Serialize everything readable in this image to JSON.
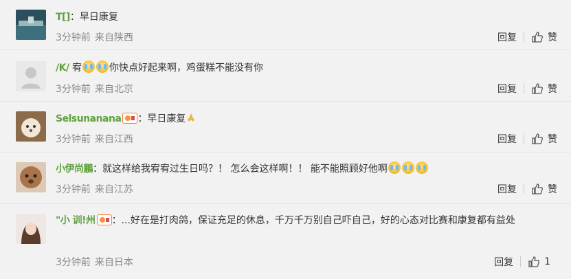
{
  "comments": [
    {
      "username": "T[]",
      "content": "：早日康复",
      "time": "3分钟前",
      "location": "来自陕西",
      "reply_label": "回复",
      "like_label": "赞"
    },
    {
      "username": "/K/",
      "content_a": "宥",
      "content_b": "你快点好起来啊，鸡蛋糕不能没有你",
      "time": "3分钟前",
      "location": "来自北京",
      "reply_label": "回复",
      "like_label": "赞"
    },
    {
      "username": "Selsunanana",
      "content": "：早日康复",
      "time": "3分钟前",
      "location": "来自江西",
      "reply_label": "回复",
      "like_label": "赞"
    },
    {
      "username": "小伊尚鵬",
      "content": "：就这样给我宥宥过生日吗？！ 怎么会这样啊！！ 能不能照顾好他啊",
      "time": "3分钟前",
      "location": "来自江苏",
      "reply_label": "回复",
      "like_label": "赞"
    },
    {
      "username": "\"小 训!州",
      "content": "：...好在是打肉鸽，保证充足的休息，千万千万别自己吓自己，好的心态对比赛和康复都有益处",
      "time": "3分钟前",
      "location": "来自日本",
      "reply_label": "回复",
      "like_count": "1"
    }
  ]
}
